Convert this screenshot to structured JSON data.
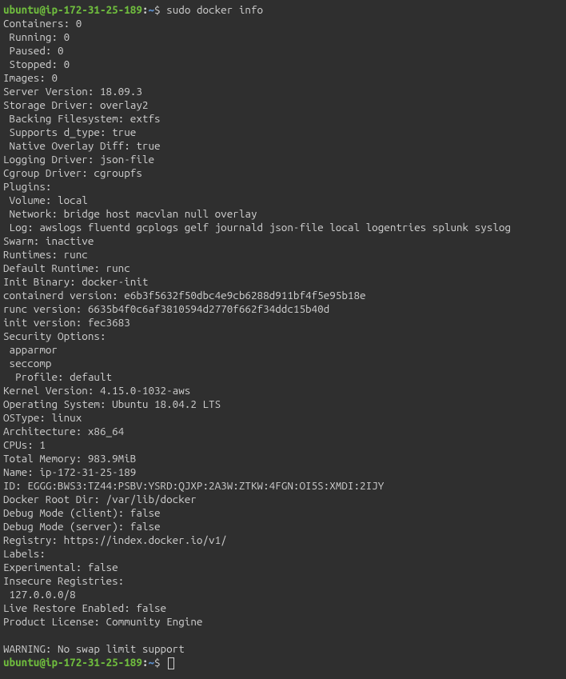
{
  "prompt1": {
    "user": "ubuntu@ip-172-31-25-189",
    "sep": ":",
    "path": "~",
    "dollar": "$ ",
    "cmd": "sudo docker info"
  },
  "lines": [
    "Containers: 0",
    " Running: 0",
    " Paused: 0",
    " Stopped: 0",
    "Images: 0",
    "Server Version: 18.09.3",
    "Storage Driver: overlay2",
    " Backing Filesystem: extfs",
    " Supports d_type: true",
    " Native Overlay Diff: true",
    "Logging Driver: json-file",
    "Cgroup Driver: cgroupfs",
    "Plugins:",
    " Volume: local",
    " Network: bridge host macvlan null overlay",
    " Log: awslogs fluentd gcplogs gelf journald json-file local logentries splunk syslog",
    "Swarm: inactive",
    "Runtimes: runc",
    "Default Runtime: runc",
    "Init Binary: docker-init",
    "containerd version: e6b3f5632f50dbc4e9cb6288d911bf4f5e95b18e",
    "runc version: 6635b4f0c6af3810594d2770f662f34ddc15b40d",
    "init version: fec3683",
    "Security Options:",
    " apparmor",
    " seccomp",
    "  Profile: default",
    "Kernel Version: 4.15.0-1032-aws",
    "Operating System: Ubuntu 18.04.2 LTS",
    "OSType: linux",
    "Architecture: x86_64",
    "CPUs: 1",
    "Total Memory: 983.9MiB",
    "Name: ip-172-31-25-189",
    "ID: EGGG:BWS3:TZ44:PSBV:YSRD:QJXP:2A3W:ZTKW:4FGN:OI5S:XMDI:2IJY",
    "Docker Root Dir: /var/lib/docker",
    "Debug Mode (client): false",
    "Debug Mode (server): false",
    "Registry: https://index.docker.io/v1/",
    "Labels:",
    "Experimental: false",
    "Insecure Registries:",
    " 127.0.0.0/8",
    "Live Restore Enabled: false",
    "Product License: Community Engine",
    "",
    "WARNING: No swap limit support"
  ],
  "prompt2": {
    "user": "ubuntu@ip-172-31-25-189",
    "sep": ":",
    "path": "~",
    "dollar": "$ "
  }
}
